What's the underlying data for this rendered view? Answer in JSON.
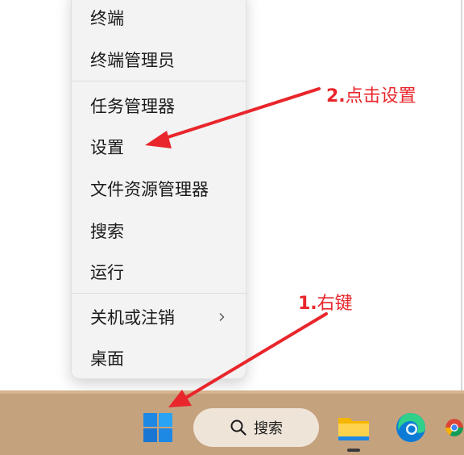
{
  "context_menu": {
    "items": [
      {
        "label": "终端"
      },
      {
        "label": "终端管理员"
      },
      {
        "label": "任务管理器"
      },
      {
        "label": "设置"
      },
      {
        "label": "文件资源管理器"
      },
      {
        "label": "搜索"
      },
      {
        "label": "运行"
      },
      {
        "label": "关机或注销"
      },
      {
        "label": "桌面"
      }
    ]
  },
  "annotations": {
    "step2": {
      "number": "2.",
      "text": "点击设置"
    },
    "step1": {
      "number": "1.",
      "text": "右键"
    }
  },
  "taskbar": {
    "search_label": "搜索",
    "icons": [
      "windows-start-icon",
      "search-icon",
      "file-explorer-icon",
      "edge-icon",
      "chrome-icon"
    ]
  },
  "colors": {
    "annotation": "#e8262b",
    "taskbar": "#c5a27e",
    "menu_bg": "#f3f3f3",
    "start_blue": "#1e88e5"
  }
}
